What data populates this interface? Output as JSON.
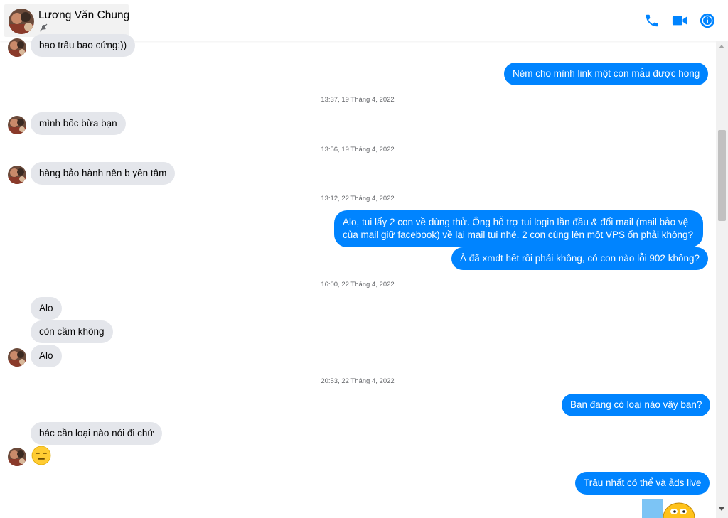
{
  "contact": {
    "name": "Lương Văn Chung",
    "status_icon": "muted-icon"
  },
  "header_actions": [
    {
      "name": "phone-call-button",
      "icon": "phone-icon"
    },
    {
      "name": "video-call-button",
      "icon": "video-icon"
    },
    {
      "name": "conversation-info-button",
      "icon": "info-icon"
    }
  ],
  "colors": {
    "accent": "#0084ff",
    "incoming_bubble": "#e4e6eb",
    "timestamp": "#65676b"
  },
  "messages": [
    {
      "id": "m1",
      "from": "them",
      "text": "bao trâu bao cứng:))"
    },
    {
      "id": "m2",
      "from": "me",
      "text": "Ném cho mình link một con mẫu được hong"
    },
    {
      "id": "t1",
      "type": "timestamp",
      "text": "13:37, 19 Tháng 4, 2022"
    },
    {
      "id": "m3",
      "from": "them",
      "text": "mình bốc bừa bạn"
    },
    {
      "id": "t2",
      "type": "timestamp",
      "text": "13:56, 19 Tháng 4, 2022"
    },
    {
      "id": "m4",
      "from": "them",
      "text": "hàng bảo hành nên b yên tâm"
    },
    {
      "id": "t3",
      "type": "timestamp",
      "text": "13:12, 22 Tháng 4, 2022"
    },
    {
      "id": "m5",
      "from": "me",
      "lines": [
        "Alo, tui lấy 2 con về dùng thử. Ông hỗ trợ tui login lần đầu & đổi mail (mail bảo vệ",
        "của mail giữ facebook) về lại mail tui nhé. 2 con cùng lên một VPS ổn phải không?"
      ]
    },
    {
      "id": "m6",
      "from": "me",
      "text": "À đã xmdt hết rồi phải không, có con nào lỗi 902 không?"
    },
    {
      "id": "t4",
      "type": "timestamp",
      "text": "16:00, 22 Tháng 4, 2022"
    },
    {
      "id": "m7",
      "from": "them",
      "text": "Alo"
    },
    {
      "id": "m8",
      "from": "them",
      "text": "còn cầm không"
    },
    {
      "id": "m9",
      "from": "them",
      "text": "Alo"
    },
    {
      "id": "t5",
      "type": "timestamp",
      "text": "20:53, 22 Tháng 4, 2022"
    },
    {
      "id": "m10",
      "from": "me",
      "text": "Bạn đang có loại nào vậy bạn?"
    },
    {
      "id": "m11",
      "from": "them",
      "text": "bác cần loại nào nói đi chứ"
    },
    {
      "id": "m12",
      "from": "them",
      "type": "emoji",
      "icon": "expressionless-face-icon"
    },
    {
      "id": "m13",
      "from": "me",
      "text": "Trâu nhất có thể và ảds live"
    },
    {
      "id": "m14",
      "from": "me",
      "type": "sticker",
      "icon": "sticker-icon"
    }
  ]
}
